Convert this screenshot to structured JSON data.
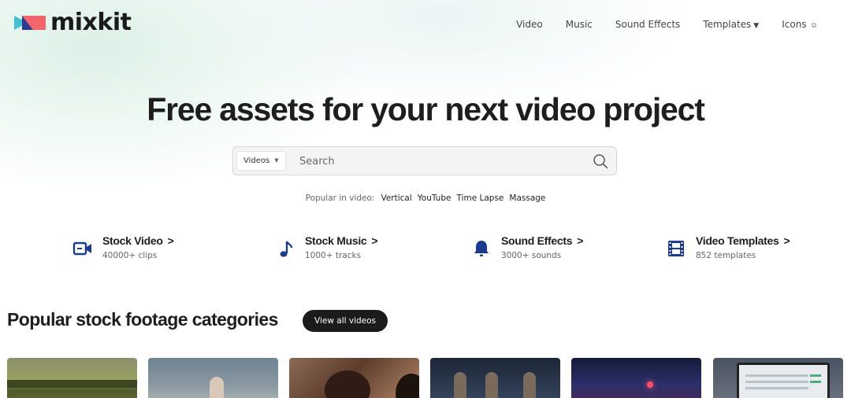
{
  "brand": {
    "name": "mixkit",
    "colors": {
      "logo_coral": "#f2656a",
      "logo_teal": "#3fc3d3",
      "logo_navy": "#2b3b8f",
      "icon_blue": "#1a3a8f",
      "dark_button": "#1b1b1b"
    }
  },
  "nav": {
    "items": [
      {
        "label": "Video"
      },
      {
        "label": "Music"
      },
      {
        "label": "Sound Effects"
      },
      {
        "label": "Templates",
        "has_dropdown": true
      },
      {
        "label": "Icons",
        "external": true
      }
    ]
  },
  "hero": {
    "title": "Free assets for your next video project"
  },
  "search": {
    "category": "Videos",
    "placeholder": "Search"
  },
  "popular": {
    "label": "Popular in video:",
    "tags": [
      "Vertical",
      "YouTube",
      "Time Lapse",
      "Massage"
    ]
  },
  "categories": [
    {
      "title": "Stock Video",
      "subtitle": "40000+ clips",
      "icon": "video-camera-icon"
    },
    {
      "title": "Stock Music",
      "subtitle": "1000+ tracks",
      "icon": "music-note-icon"
    },
    {
      "title": "Sound Effects",
      "subtitle": "3000+ sounds",
      "icon": "bell-icon"
    },
    {
      "title": "Video Templates",
      "subtitle": "852 templates",
      "icon": "film-strip-icon"
    }
  ],
  "section": {
    "title": "Popular stock footage categories",
    "button": "View all videos"
  },
  "icons": {
    "external_link": "external-link-icon",
    "caret_down": "caret-down-icon",
    "chevron_right": "chevron-right-icon",
    "search": "search-icon"
  }
}
